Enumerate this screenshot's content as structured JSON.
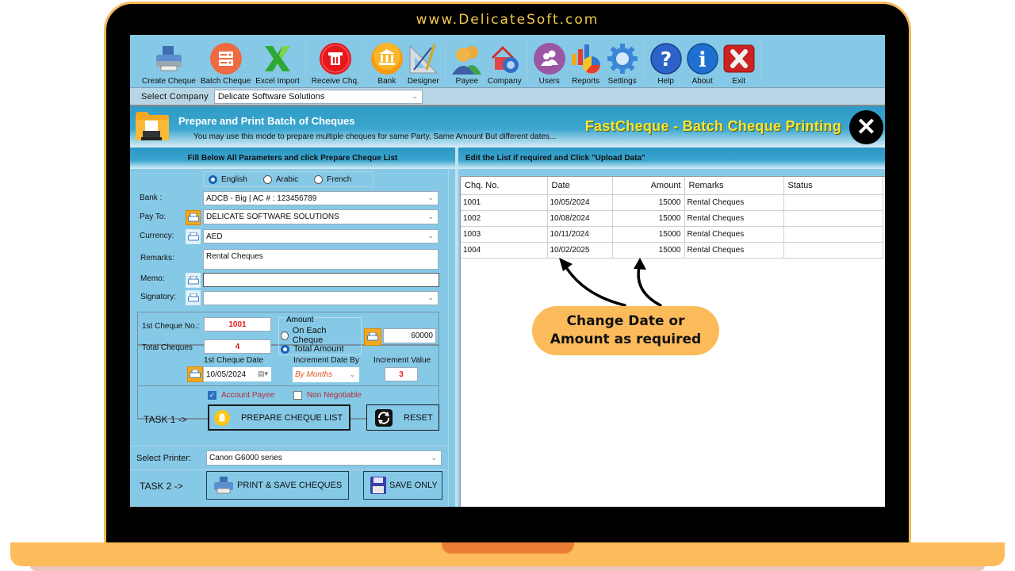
{
  "site_url": "www.DelicateSoft.com",
  "toolbar": {
    "items": [
      {
        "label": "Create Cheque",
        "icon": "printer-icon"
      },
      {
        "label": "Batch Cheque",
        "icon": "batch-cheque-icon"
      },
      {
        "label": "Excel Import",
        "icon": "excel-icon"
      },
      {
        "label": "Receive Chq.",
        "icon": "receive-cheque-icon"
      },
      {
        "label": "Bank",
        "icon": "bank-icon"
      },
      {
        "label": "Designer",
        "icon": "designer-icon"
      },
      {
        "label": "Payee",
        "icon": "payee-icon"
      },
      {
        "label": "Company",
        "icon": "company-icon"
      },
      {
        "label": "Users",
        "icon": "users-icon"
      },
      {
        "label": "Reports",
        "icon": "reports-icon"
      },
      {
        "label": "Settings",
        "icon": "settings-gear-icon"
      },
      {
        "label": "Help",
        "icon": "help-icon"
      },
      {
        "label": "About",
        "icon": "info-icon"
      },
      {
        "label": "Exit",
        "icon": "exit-icon"
      }
    ]
  },
  "company": {
    "label": "Select Company",
    "value": "Delicate Software Solutions"
  },
  "banner": {
    "title": "Prepare and Print Batch of Cheques",
    "subtitle": "You may use this mode to prepare multiple cheques for same Party, Same Amount But different dates...",
    "brand": "FastCheque - Batch Cheque Printing",
    "close_symbol": "✕"
  },
  "left_header": "Fill Below All Parameters and click Prepare Cheque List",
  "right_header": "Edit the List if required and Click \"Upload Data\"",
  "language": {
    "options": [
      "English",
      "Arabic",
      "French"
    ],
    "selected": "English"
  },
  "form": {
    "bank_label": "Bank :",
    "bank_value": "ADCB - Big | AC # :  123456789",
    "payto_label": "Pay To:",
    "payto_value": "DELICATE SOFTWARE SOLUTIONS",
    "currency_label": "Currency:",
    "currency_value": "AED",
    "remarks_label": "Remarks:",
    "remarks_value": "Rental Cheques",
    "memo_label": "Memo:",
    "memo_value": "",
    "signatory_label": "Signatory:",
    "signatory_value": "",
    "first_cheque_no_label": "1st Cheque No.:",
    "first_cheque_no": "1001",
    "total_cheques_label": "Total Cheques",
    "total_cheques": "4",
    "amount_group_label": "Amount",
    "amount_options": [
      "On Each Cheque",
      "Total Amount"
    ],
    "amount_selected": "Total Amount",
    "amount_value": "60000",
    "first_cheque_date_label": "1st Cheque Date",
    "first_cheque_date": "10/05/2024",
    "increment_by_label": "Increment Date By",
    "increment_by": "By Months",
    "increment_value_label": "Increment Value",
    "increment_value": "3",
    "account_payee_label": "Account Payee",
    "account_payee_checked": true,
    "non_negotiable_label": "Non Negotiable",
    "non_negotiable_checked": false
  },
  "task1": {
    "label": "TASK 1 ->",
    "prepare_button": "PREPARE CHEQUE LIST",
    "reset_button": "RESET"
  },
  "task2": {
    "printer_label": "Select Printer:",
    "printer_value": "Canon G6000 series",
    "label": "TASK 2 ->",
    "print_save_button": "PRINT & SAVE CHEQUES",
    "save_only_button": "SAVE ONLY"
  },
  "grid": {
    "columns": [
      "Chq. No.",
      "Date",
      "Amount",
      "Remarks",
      "Status"
    ],
    "rows": [
      {
        "chq_no": "1001",
        "date": "10/05/2024",
        "amount": "15000",
        "remarks": "Rental Cheques",
        "status": ""
      },
      {
        "chq_no": "1002",
        "date": "10/08/2024",
        "amount": "15000",
        "remarks": "Rental Cheques",
        "status": ""
      },
      {
        "chq_no": "1003",
        "date": "10/11/2024",
        "amount": "15000",
        "remarks": "Rental Cheques",
        "status": ""
      },
      {
        "chq_no": "1004",
        "date": "10/02/2025",
        "amount": "15000",
        "remarks": "Rental Cheques",
        "status": ""
      }
    ]
  },
  "callout": {
    "line1": "Change Date or",
    "line2": "Amount as required"
  },
  "colors": {
    "frame_orange": "#fdbc5b",
    "notch_orange": "#ec7d36",
    "app_blue": "#86c9e6",
    "brand_yellow": "#f5e53a",
    "red_value": "#e0231f"
  }
}
